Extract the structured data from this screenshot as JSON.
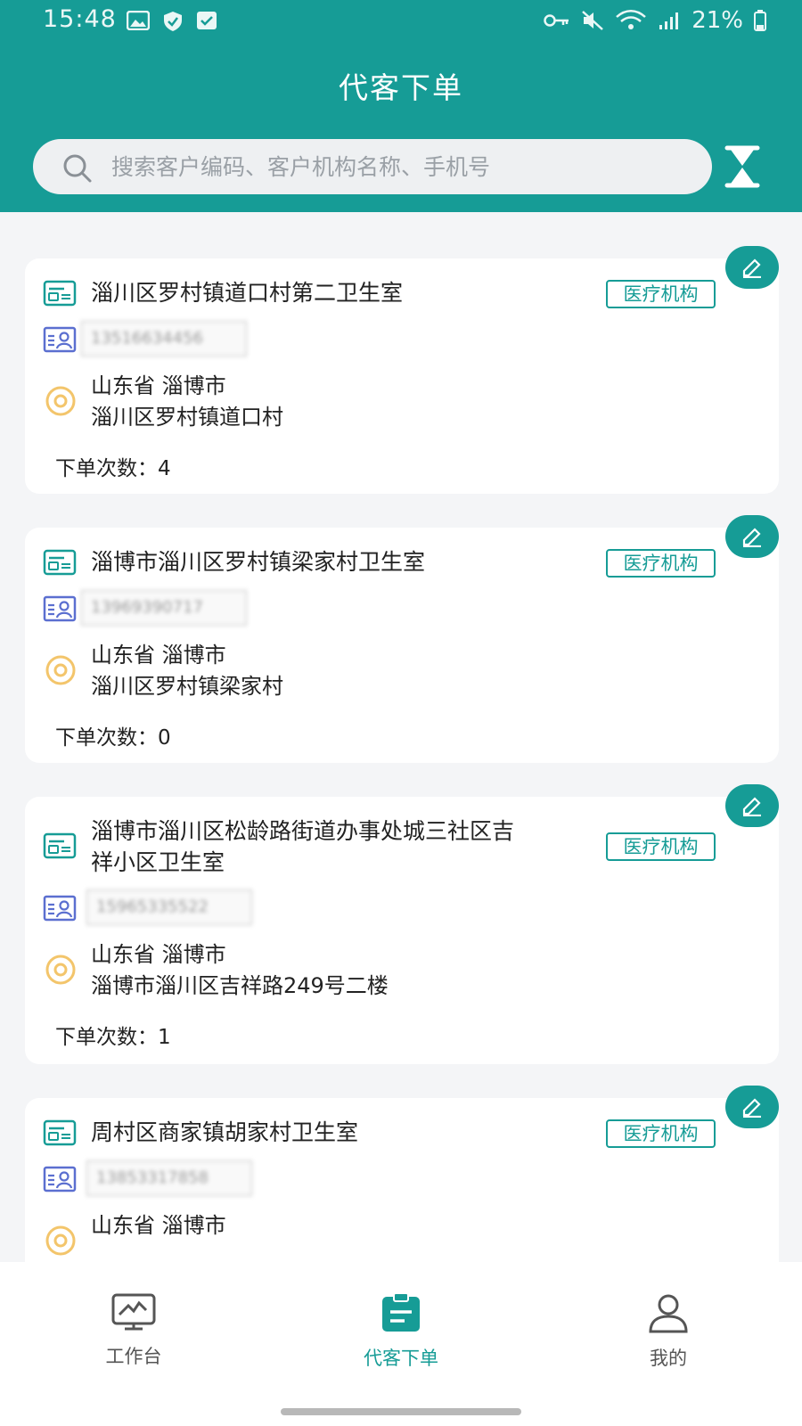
{
  "status_bar": {
    "time": "15:48",
    "battery": "21%"
  },
  "header": {
    "title": "代客下单"
  },
  "search": {
    "placeholder": "搜索客户编码、客户机构名称、手机号"
  },
  "customers": [
    {
      "name_line1": "淄川区罗村镇道口村第二卫生室",
      "name_line2": "",
      "tag": "医疗机构",
      "phone": "13516634456",
      "province_city": "山东省 淄博市",
      "address": "淄川区罗村镇道口村",
      "order_count_label": "下单次数：",
      "order_count": "4"
    },
    {
      "name_line1": "淄博市淄川区罗村镇梁家村卫生室",
      "name_line2": "",
      "tag": "医疗机构",
      "phone": "13969390717",
      "province_city": "山东省 淄博市",
      "address": "淄川区罗村镇梁家村",
      "order_count_label": "下单次数：",
      "order_count": "0"
    },
    {
      "name_line1": "淄博市淄川区松龄路街道办事处城三社区吉",
      "name_line2": "祥小区卫生室",
      "tag": "医疗机构",
      "phone": "15965335522",
      "province_city": "山东省 淄博市",
      "address": "淄博市淄川区吉祥路249号二楼",
      "order_count_label": "下单次数：",
      "order_count": "1"
    },
    {
      "name_line1": "周村区商家镇胡家村卫生室",
      "name_line2": "",
      "tag": "医疗机构",
      "phone": "13853317858",
      "province_city": "山东省 淄博市",
      "address": "",
      "order_count_label": "",
      "order_count": ""
    }
  ],
  "bottom_nav": [
    {
      "label": "工作台",
      "icon": "monitor-icon",
      "active": false
    },
    {
      "label": "代客下单",
      "icon": "clipboard-icon",
      "active": true
    },
    {
      "label": "我的",
      "icon": "user-icon",
      "active": false
    }
  ],
  "colors": {
    "primary": "#169c96",
    "tag_border": "#169c96",
    "loc_icon": "#f3c56b",
    "id_icon": "#5b6fd0"
  }
}
